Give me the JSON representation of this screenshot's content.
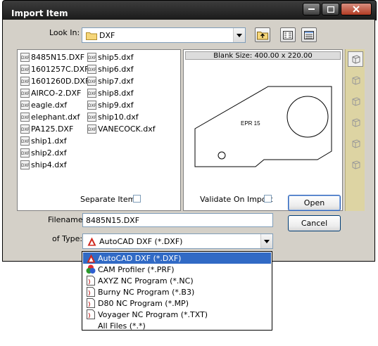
{
  "window": {
    "title": "Import Item"
  },
  "look_in": {
    "label": "Look In:",
    "value": "DXF"
  },
  "files_col1": [
    "8485N15.DXF",
    "1601257C.DXF",
    "1601260D.DXF",
    "AIRCO-2.DXF",
    "eagle.dxf",
    "elephant.dxf",
    "PA125.DXF",
    "ship1.dxf",
    "ship2.dxf",
    "ship4.dxf"
  ],
  "files_col2": [
    "ship5.dxf",
    "ship6.dxf",
    "ship7.dxf",
    "ship8.dxf",
    "ship9.dxf",
    "ship10.dxf",
    "VANECOCK.dxf"
  ],
  "file_icon_text": "DXF",
  "preview": {
    "header": "Blank Size: 400.00 x 220.00",
    "part_label": "EPR 15"
  },
  "options": {
    "separate_items": "Separate Items",
    "validate_on_import": "Validate On Import"
  },
  "filename": {
    "label": "Filename:",
    "value": "8485N15.DXF"
  },
  "type": {
    "label": "of Type:",
    "value": "AutoCAD DXF (*.DXF)"
  },
  "type_options": [
    "AutoCAD DXF (*.DXF)",
    "CAM Profiler (*.PRF)",
    "AXYZ NC Program (*.NC)",
    "Burny NC Program (*.B3)",
    "D80 NC Program (*.MP)",
    "Voyager NC Program (*.TXT)",
    "All Files (*.*)"
  ],
  "buttons": {
    "open": "Open",
    "cancel": "Cancel"
  },
  "icons": {
    "up_folder": "up-folder-icon",
    "list_view": "list-view-icon",
    "details_view": "details-view-icon"
  },
  "colors": {
    "selection": "#316ac5",
    "dialog_bg": "#d4d0c8",
    "toolbar_bg": "#ddd4a3"
  }
}
